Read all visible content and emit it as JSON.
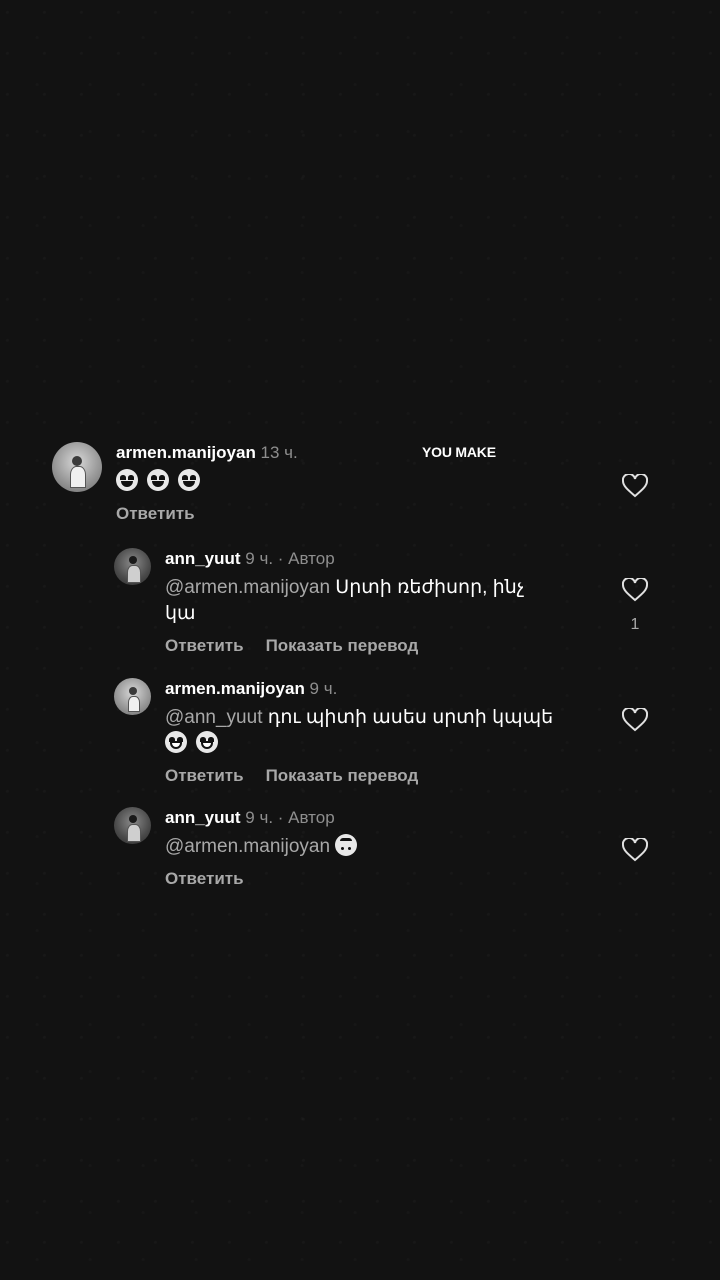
{
  "overlay_text": "YOU MAKE",
  "comments": [
    {
      "username": "armen.manijoyan",
      "meta": " 13 ч.",
      "reply_label": "Ответить",
      "emoji": [
        "heart-eyes",
        "heart-eyes",
        "heart-eyes"
      ]
    },
    {
      "username": "ann_yuut",
      "meta": " 9 ч. · Автор",
      "mention": "@armen.manijoyan",
      "text": " Սրտի ռեժիսոր, ինչ",
      "text_cont": "կա",
      "reply_label": "Ответить",
      "translate_label": "Показать перевод",
      "like_count": "1"
    },
    {
      "username": "armen.manijoyan",
      "meta": " 9 ч.",
      "mention": "@ann_yuut",
      "text": " դու պիտի ասես սրտի կպպե",
      "emoji": [
        "grinning",
        "grinning"
      ],
      "reply_label": "Ответить",
      "translate_label": "Показать перевод"
    },
    {
      "username": "ann_yuut",
      "meta": " 9 ч. · Автор",
      "mention": "@armen.manijoyan",
      "emoji": [
        "upside-down-face"
      ],
      "reply_label": "Ответить"
    }
  ],
  "colors": {
    "background": "#121212",
    "text": "#ffffff",
    "secondary": "#a8a8a8",
    "meta": "#8e8e8e"
  }
}
